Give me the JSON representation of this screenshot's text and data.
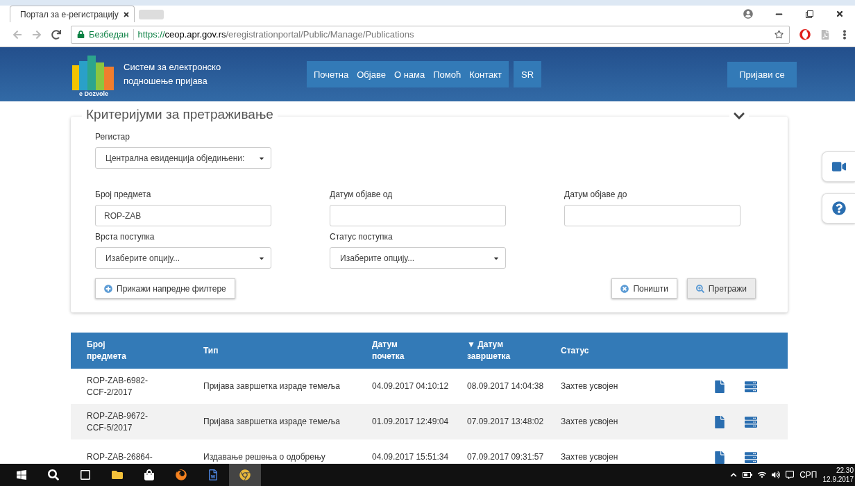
{
  "browser": {
    "tab_title": "Портал за е-регистрацију",
    "secure_label": "Безбедан",
    "url_scheme": "https://",
    "url_host": "ceop.apr.gov.rs",
    "url_path": "/eregistrationportal/Public/Manage/Publications"
  },
  "header": {
    "logo_caption": "e Dozvole",
    "title_line_1": "Систем за електронско",
    "title_line_2": "подношење пријава",
    "nav": [
      {
        "label": "Почетна"
      },
      {
        "label": "Објаве"
      },
      {
        "label": "О нама"
      },
      {
        "label": "Помоћ"
      },
      {
        "label": "Контакт"
      }
    ],
    "language": "SR",
    "login": "Пријави се"
  },
  "search": {
    "title": "Критеријуми за претраживање",
    "expanded": true,
    "register": {
      "label": "Регистар",
      "value": "Централна евиденција обједињени:"
    },
    "fields": [
      {
        "kind": "text",
        "label": "Број предмета",
        "value": "ROP-ZAB"
      },
      {
        "kind": "text",
        "label": "Датум објаве од"
      },
      {
        "kind": "text",
        "label": "Датум објаве до"
      },
      {
        "kind": "select",
        "label": "Врста поступка",
        "value": "Изаберите опцију..."
      },
      {
        "kind": "select",
        "label": "Статус поступка",
        "value": "Изаберите опцију..."
      }
    ],
    "advanced": "Прикажи напредне филтере",
    "reset": "Поништи",
    "submit": "Претражи"
  },
  "table": {
    "columns": [
      {
        "label": "Број предмета",
        "sorted": false
      },
      {
        "label": "Тип",
        "sorted": false
      },
      {
        "label": "Датум почетка",
        "sorted": false
      },
      {
        "label": "Датум завршетка",
        "sorted": true,
        "sort_icon": "▼"
      },
      {
        "label": "Статус",
        "sorted": false
      }
    ],
    "rows": [
      {
        "number": "ROP-ZAB-6982-CCF-2/2017",
        "type": "Пријава завршетка израде темеља",
        "start": "04.09.2017 04:10:12",
        "end": "08.09.2017 14:04:38",
        "status": "Захтев усвојен"
      },
      {
        "number": "ROP-ZAB-9672-CCF-5/2017",
        "type": "Пријава завршетка израде темеља",
        "start": "01.09.2017 12:49:04",
        "end": "07.09.2017 13:48:02",
        "status": "Захтев усвојен"
      },
      {
        "number": "ROP-ZAB-26864-",
        "type": "Издавање решења о одобрењу",
        "start": "04.09.2017 15:51:34",
        "end": "07.09.2017 09:31:57",
        "status": "Захтев усвојен"
      }
    ]
  },
  "taskbar": {
    "language": "СРП",
    "time": "22.30",
    "date": "12.9.2017"
  }
}
